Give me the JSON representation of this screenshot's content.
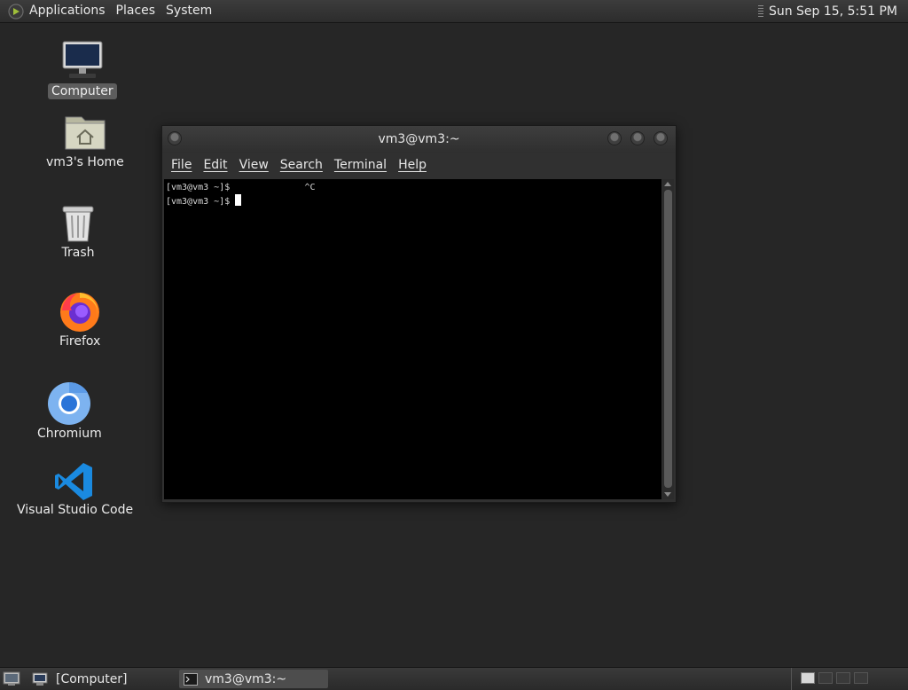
{
  "top_panel": {
    "menus": [
      "Applications",
      "Places",
      "System"
    ],
    "clock": "Sun Sep 15,  5:51 PM"
  },
  "desktop": {
    "icons": [
      {
        "label": "Computer",
        "icon": "computer-icon",
        "selected": true
      },
      {
        "label": "vm3's Home",
        "icon": "home-folder-icon"
      },
      {
        "label": "Trash",
        "icon": "trash-icon"
      },
      {
        "label": "Firefox",
        "icon": "firefox-icon"
      },
      {
        "label": "Chromium",
        "icon": "chromium-icon"
      },
      {
        "label": "Visual Studio Code",
        "icon": "vscode-icon"
      }
    ]
  },
  "terminal": {
    "title": "vm3@vm3:~",
    "menus": [
      "File",
      "Edit",
      "View",
      "Search",
      "Terminal",
      "Help"
    ],
    "lines": [
      "[vm3@vm3 ~]$              ^C",
      "[vm3@vm3 ~]$ "
    ]
  },
  "taskbar": {
    "items": [
      "[Computer]",
      "vm3@vm3:~"
    ]
  },
  "colors": {
    "desktop_bg": "#262626",
    "terminal_bg": "#000000",
    "text": "#e6e6e6"
  }
}
